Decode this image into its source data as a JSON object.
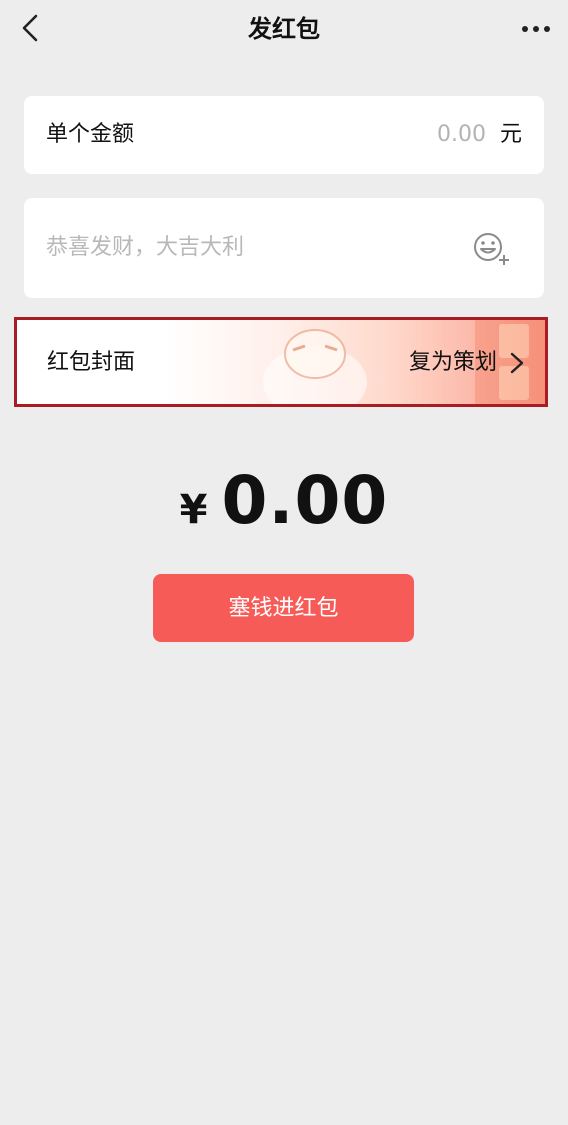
{
  "header": {
    "title": "发红包",
    "back_icon": "chevron-left-icon",
    "more_icon": "more-dots-icon"
  },
  "amount": {
    "label": "单个金额",
    "value": "0.00",
    "unit": "元"
  },
  "message": {
    "placeholder": "恭喜发财，大吉大利",
    "emoji_icon": "emoji-add-icon"
  },
  "cover": {
    "label": "红包封面",
    "value": "复为策划",
    "chevron_icon": "chevron-right-icon"
  },
  "total": {
    "symbol": "¥",
    "amount": "0.00"
  },
  "submit": {
    "label": "塞钱进红包"
  },
  "colors": {
    "background": "#ededed",
    "button": "#f65b58",
    "highlight_border": "#a71d23"
  }
}
